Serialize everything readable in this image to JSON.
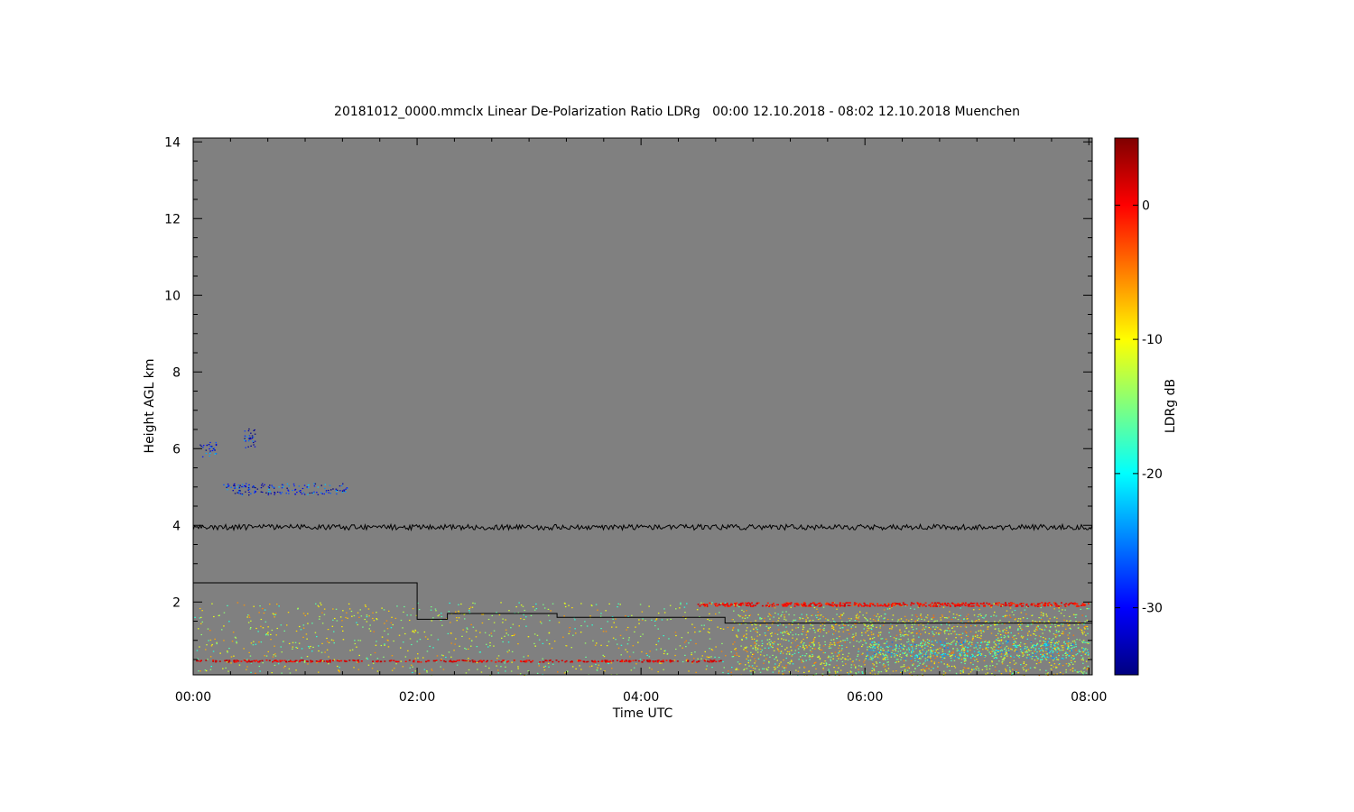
{
  "chart_data": {
    "type": "heatmap",
    "title": "20181012_0000.mmclx Linear De-Polarization Ratio LDRg   00:00 12.10.2018 - 08:02 12.10.2018 Muenchen",
    "xlabel": "Time UTC",
    "ylabel": "Height AGL km",
    "colorbar_label": "LDRg dB",
    "x_ticks": [
      "00:00",
      "02:00",
      "04:00",
      "06:00",
      "08:00"
    ],
    "x_range_hours": [
      0,
      8.03
    ],
    "y_ticks": [
      2,
      4,
      6,
      8,
      10,
      12,
      14
    ],
    "y_range_km": [
      0.1,
      14.1
    ],
    "colorbar_ticks": [
      0,
      -10,
      -20,
      -30
    ],
    "colorbar_range_db": [
      -35,
      5
    ],
    "colormap": [
      "#00007f",
      "#0000ff",
      "#007fff",
      "#00ffff",
      "#7fff7f",
      "#ffff00",
      "#ff7f00",
      "#ff0000",
      "#7f0000"
    ],
    "background_color": "#808080",
    "overlay_color": "#000000",
    "overlay_lines": [
      {
        "name": "",
        "type": "constant-noisy",
        "y_km": 3.95
      },
      {
        "name": "",
        "type": "step",
        "points": [
          [
            0,
            2.5
          ],
          [
            2.0,
            2.5
          ],
          [
            2.0,
            1.55
          ],
          [
            2.27,
            1.55
          ],
          [
            2.27,
            1.7
          ],
          [
            3.25,
            1.7
          ],
          [
            3.25,
            1.6
          ],
          [
            4.75,
            1.6
          ],
          [
            4.75,
            1.45
          ],
          [
            8.03,
            1.45
          ]
        ]
      }
    ],
    "echo_regions": [
      {
        "t": [
          0.0,
          8.0
        ],
        "h": [
          0.1,
          2.0
        ],
        "ldr_db": -12,
        "note": "scattered low-level echoes"
      },
      {
        "t": [
          4.8,
          8.0
        ],
        "h": [
          0.1,
          1.7
        ],
        "ldr_db": -11,
        "note": "dense yellow layer"
      },
      {
        "t": [
          6.0,
          8.0
        ],
        "h": [
          0.5,
          1.0
        ],
        "ldr_db": -19,
        "note": "cyan band"
      },
      {
        "t": [
          0.0,
          4.75
        ],
        "h": [
          0.45,
          0.5
        ],
        "ldr_db": 1,
        "note": "red line near ground"
      },
      {
        "t": [
          4.5,
          8.0
        ],
        "h": [
          1.9,
          2.0
        ],
        "ldr_db": 0,
        "note": "red line"
      },
      {
        "t": [
          0.05,
          0.2
        ],
        "h": [
          5.8,
          6.2
        ],
        "ldr_db": -29,
        "note": "blue patch"
      },
      {
        "t": [
          0.45,
          0.55
        ],
        "h": [
          6.0,
          6.6
        ],
        "ldr_db": -29,
        "note": "blue patch"
      },
      {
        "t": [
          0.25,
          1.4
        ],
        "h": [
          4.8,
          5.1
        ],
        "ldr_db": -29,
        "note": "blue patch"
      }
    ]
  }
}
